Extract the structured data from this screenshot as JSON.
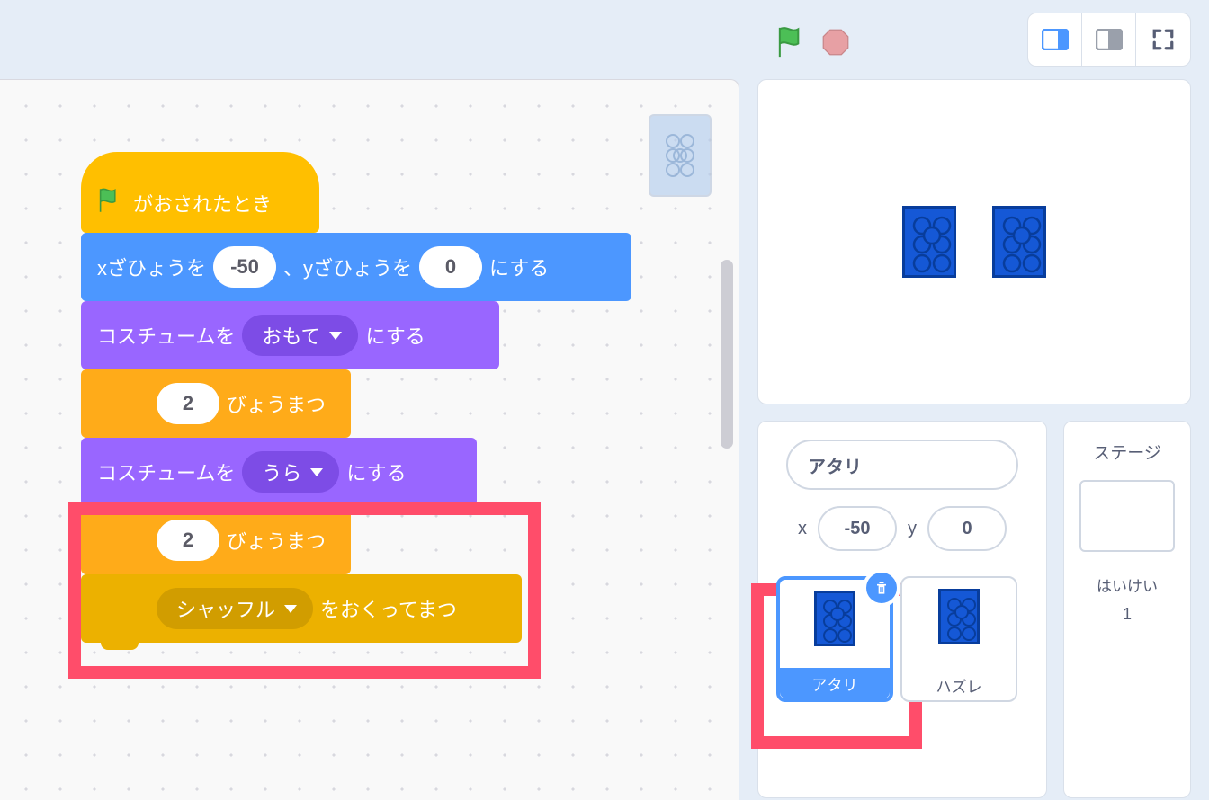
{
  "blocks": {
    "hat": "がおされたとき",
    "goto_pre": "xざひょうを",
    "goto_x": "-50",
    "goto_mid": "、yざひょうを",
    "goto_y": "0",
    "goto_suf": "にする",
    "costume1_pre": "コスチュームを",
    "costume1_dd": "おもて",
    "costume1_suf": "にする",
    "wait1_val": "2",
    "wait1_suf": "びょうまつ",
    "costume2_pre": "コスチュームを",
    "costume2_dd": "うら",
    "costume2_suf": "にする",
    "wait2_val": "2",
    "wait2_suf": "びょうまつ",
    "broadcast_dd": "シャッフル",
    "broadcast_suf": "をおくってまつ"
  },
  "sprite_info": {
    "name": "アタリ",
    "x_label": "x",
    "x_value": "-50",
    "y_label": "y",
    "y_value": "0"
  },
  "sprites": [
    {
      "name": "アタリ",
      "selected": true
    },
    {
      "name": "ハズレ",
      "selected": false
    }
  ],
  "stage": {
    "title": "ステージ",
    "backdrop_label": "はいけい",
    "backdrop_count": "1"
  }
}
